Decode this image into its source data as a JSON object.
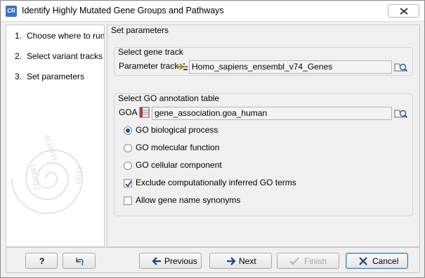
{
  "window": {
    "app_icon_text": "CR",
    "title": "Identify Highly Mutated Gene Groups and Pathways"
  },
  "steps": [
    {
      "num": "1.",
      "label": "Choose where to run"
    },
    {
      "num": "2.",
      "label": "Select variant tracks"
    },
    {
      "num": "3.",
      "label": "Set parameters"
    }
  ],
  "panel": {
    "title": "Set parameters",
    "gene_track": {
      "group_label": "Select gene track",
      "field_label": "Parameter track",
      "value": "Homo_sapiens_ensembl_v74_Genes"
    },
    "go_table": {
      "group_label": "Select GO annotation table",
      "field_label": "GOA",
      "value": "gene_association.goa_human"
    },
    "options": [
      {
        "kind": "radio",
        "label": "GO biological process",
        "checked": true
      },
      {
        "kind": "radio",
        "label": "GO molecular function",
        "checked": false
      },
      {
        "kind": "radio",
        "label": "GO cellular component",
        "checked": false
      },
      {
        "kind": "checkbox",
        "label": "Exclude computationally inferred GO terms",
        "checked": true
      },
      {
        "kind": "checkbox",
        "label": "Allow gene name synonyms",
        "checked": false
      }
    ]
  },
  "footer": {
    "help_label": "?",
    "previous_label": "Previous",
    "next_label": "Next",
    "finish_label": "Finish",
    "cancel_label": "Cancel"
  },
  "colors": {
    "accent": "#3c7fb1",
    "selection": "#1c4b8c",
    "window_bg": "#f0f0f0"
  }
}
